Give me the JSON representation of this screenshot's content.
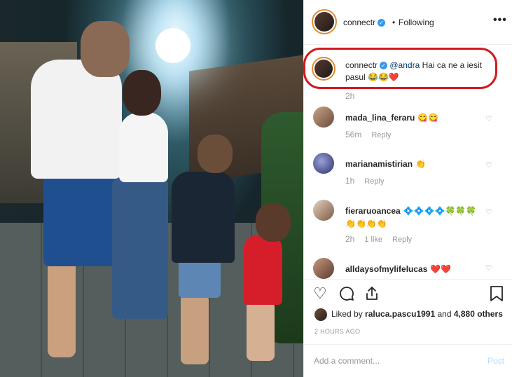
{
  "header": {
    "username": "connectr",
    "separator": "•",
    "follow_status": "Following",
    "more_label": "•••"
  },
  "caption": {
    "username": "connectr",
    "mention": "@andra",
    "text": "Hai ca ne a iesit pasul 😂😂❤️",
    "time": "2h"
  },
  "comments": [
    {
      "username": "mada_lina_feraru",
      "text": "😋😋",
      "time": "56m",
      "likes": "",
      "reply": "Reply"
    },
    {
      "username": "marianamistirian",
      "text": "👏",
      "time": "1h",
      "likes": "",
      "reply": "Reply"
    },
    {
      "username": "fieraruoancea",
      "text": "💠💠💠💠🍀🍀🍀👏👏👏👏",
      "time": "2h",
      "likes": "1 like",
      "reply": "Reply"
    },
    {
      "username": "alldaysofmylifelucas",
      "text": "❤️❤️",
      "time": "",
      "likes": "",
      "reply": ""
    }
  ],
  "likes": {
    "prefix": "Liked by",
    "user": "raluca.pascu1991",
    "connector": "and",
    "others": "4,880 others"
  },
  "date": "2 HOURS AGO",
  "add_comment": {
    "placeholder": "Add a comment...",
    "post_label": "Post"
  },
  "colors": {
    "verified": "#3897f0",
    "highlight_box": "#d21a1e",
    "post_disabled": "#b2dffc",
    "muted": "#999999"
  }
}
